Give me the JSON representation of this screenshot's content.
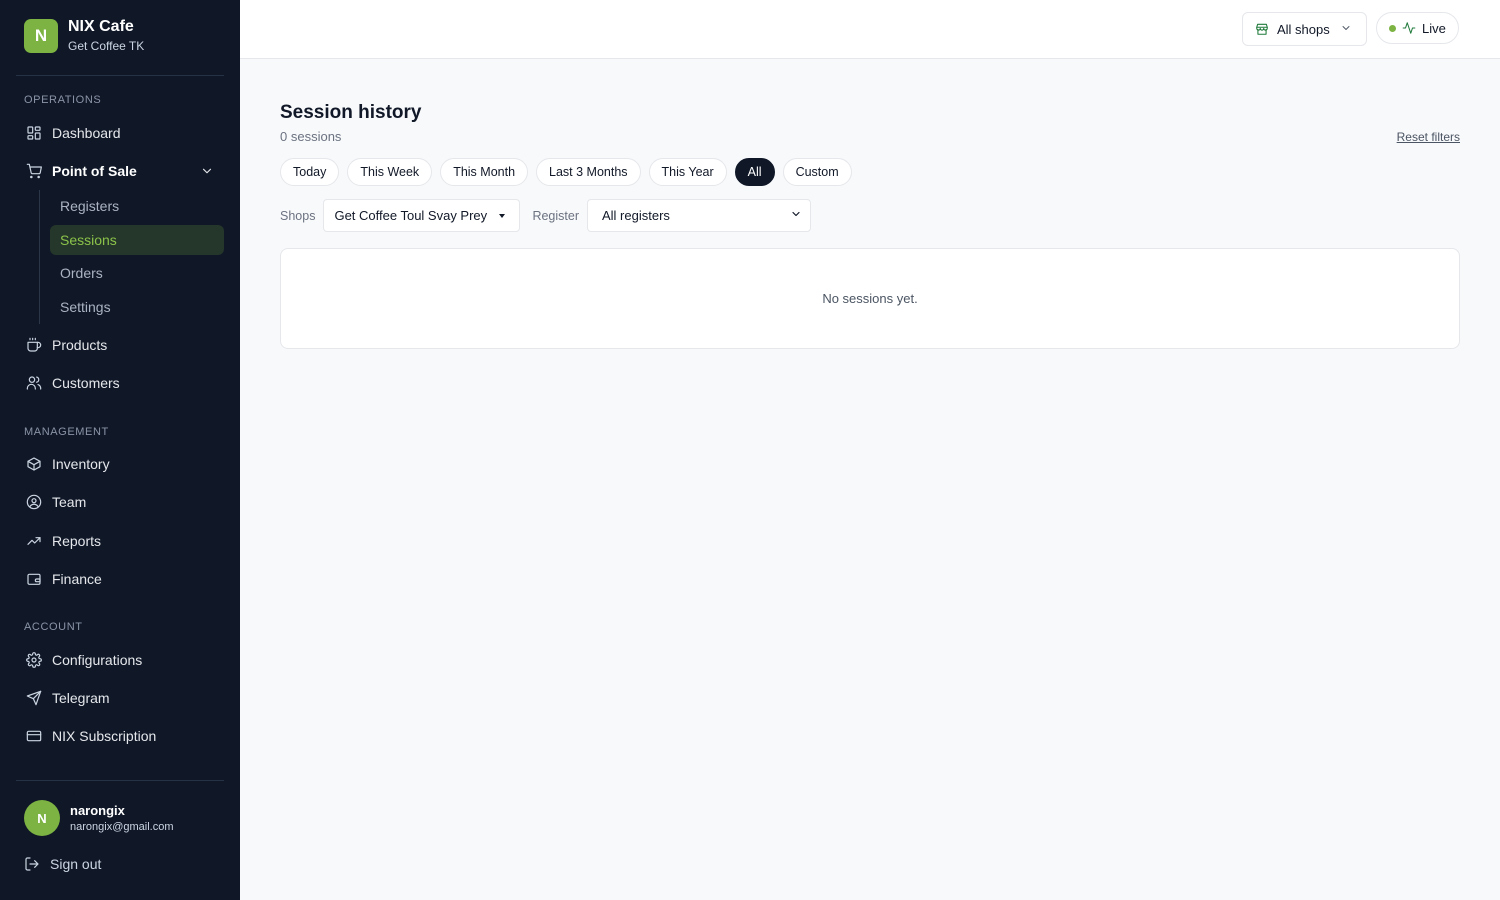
{
  "brand": {
    "logo_letter": "N",
    "name": "NIX Cafe",
    "subtitle": "Get Coffee TK",
    "accent_color": "#7cb342"
  },
  "sidebar": {
    "sections": {
      "operations": "OPERATIONS",
      "management": "MANAGEMENT",
      "account": "ACCOUNT"
    },
    "items": {
      "dashboard": {
        "label": "Dashboard",
        "icon": "dashboard-icon"
      },
      "pos": {
        "label": "Point of Sale",
        "icon": "cart-icon",
        "expanded": true
      },
      "products": {
        "label": "Products",
        "icon": "coffee-icon"
      },
      "customers": {
        "label": "Customers",
        "icon": "users-icon"
      },
      "inventory": {
        "label": "Inventory",
        "icon": "box-icon"
      },
      "team": {
        "label": "Team",
        "icon": "user-circle-icon"
      },
      "reports": {
        "label": "Reports",
        "icon": "trend-icon"
      },
      "finance": {
        "label": "Finance",
        "icon": "wallet-icon"
      },
      "configurations": {
        "label": "Configurations",
        "icon": "gear-icon"
      },
      "telegram": {
        "label": "Telegram",
        "icon": "send-icon"
      },
      "subscription": {
        "label": "NIX Subscription",
        "icon": "card-icon"
      }
    },
    "pos_sub": {
      "registers": "Registers",
      "sessions": "Sessions",
      "orders": "Orders",
      "settings": "Settings"
    },
    "active_sub": "Sessions"
  },
  "user": {
    "initial": "N",
    "name": "narongix",
    "email": "narongix@gmail.com",
    "signout": "Sign out"
  },
  "header": {
    "shop_selector": "All shops",
    "live": "Live"
  },
  "main": {
    "title": "Session history",
    "count": "0 sessions",
    "reset": "Reset filters",
    "ranges": [
      "Today",
      "This Week",
      "This Month",
      "Last 3 Months",
      "This Year",
      "All",
      "Custom"
    ],
    "active_range": "All",
    "shops_label": "Shops",
    "shops_value": "Get Coffee Toul Svay Prey",
    "register_label": "Register",
    "register_value": "All registers",
    "empty_message": "No sessions yet."
  }
}
